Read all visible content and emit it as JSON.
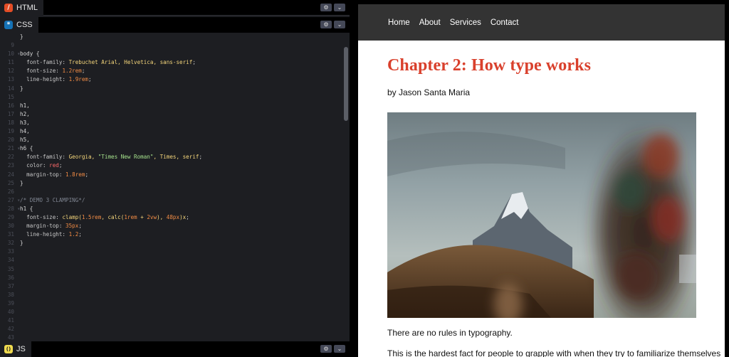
{
  "editor": {
    "html_tab": {
      "label": "HTML",
      "badge": "/"
    },
    "css_tab": {
      "label": "CSS",
      "badge": "*"
    },
    "js_tab": {
      "label": "JS",
      "badge": "()"
    },
    "settings_glyph": "⚙",
    "collapse_glyph": "⌄",
    "lines": [
      {
        "n": "",
        "fold": "",
        "t": [
          [
            "sel",
            "}"
          ]
        ]
      },
      {
        "n": "9",
        "fold": "",
        "t": []
      },
      {
        "n": "10",
        "fold": "▾",
        "t": [
          [
            "sel",
            "body {"
          ]
        ]
      },
      {
        "n": "11",
        "fold": "",
        "t": [
          [
            "prop",
            "  font-family: "
          ],
          [
            "val",
            "Trebuchet Arial, Helvetica, sans-serif"
          ],
          [
            "prop",
            ";"
          ]
        ]
      },
      {
        "n": "12",
        "fold": "",
        "t": [
          [
            "prop",
            "  font-size: "
          ],
          [
            "num",
            "1.2rem"
          ],
          [
            "prop",
            ";"
          ]
        ]
      },
      {
        "n": "13",
        "fold": "",
        "t": [
          [
            "prop",
            "  line-height: "
          ],
          [
            "num",
            "1.9rem"
          ],
          [
            "prop",
            ";"
          ]
        ]
      },
      {
        "n": "14",
        "fold": "",
        "t": [
          [
            "sel",
            "}"
          ]
        ]
      },
      {
        "n": "15",
        "fold": "",
        "t": []
      },
      {
        "n": "16",
        "fold": "",
        "t": [
          [
            "sel",
            "h1,"
          ]
        ]
      },
      {
        "n": "17",
        "fold": "",
        "t": [
          [
            "sel",
            "h2,"
          ]
        ]
      },
      {
        "n": "18",
        "fold": "",
        "t": [
          [
            "sel",
            "h3,"
          ]
        ]
      },
      {
        "n": "19",
        "fold": "",
        "t": [
          [
            "sel",
            "h4,"
          ]
        ]
      },
      {
        "n": "20",
        "fold": "",
        "t": [
          [
            "sel",
            "h5,"
          ]
        ]
      },
      {
        "n": "21",
        "fold": "▾",
        "t": [
          [
            "sel",
            "h6 {"
          ]
        ]
      },
      {
        "n": "22",
        "fold": "",
        "t": [
          [
            "prop",
            "  font-family: "
          ],
          [
            "val",
            "Georgia, "
          ],
          [
            "str",
            "\"Times New Roman\""
          ],
          [
            "val",
            ", Times, serif"
          ],
          [
            "prop",
            ";"
          ]
        ]
      },
      {
        "n": "23",
        "fold": "",
        "t": [
          [
            "prop",
            "  color: "
          ],
          [
            "kw",
            "red"
          ],
          [
            "prop",
            ";"
          ]
        ]
      },
      {
        "n": "24",
        "fold": "",
        "t": [
          [
            "prop",
            "  margin-top: "
          ],
          [
            "num",
            "1.8rem"
          ],
          [
            "prop",
            ";"
          ]
        ]
      },
      {
        "n": "25",
        "fold": "",
        "t": [
          [
            "sel",
            "}"
          ]
        ]
      },
      {
        "n": "26",
        "fold": "",
        "t": []
      },
      {
        "n": "27",
        "fold": "▾",
        "t": [
          [
            "cmt",
            "/* DEMO 3 CLAMPING*/"
          ]
        ]
      },
      {
        "n": "28",
        "fold": "▾",
        "t": [
          [
            "sel",
            "h1 {"
          ]
        ]
      },
      {
        "n": "29",
        "fold": "",
        "t": [
          [
            "prop",
            "  font-size: "
          ],
          [
            "val",
            "clamp("
          ],
          [
            "num",
            "1.5rem"
          ],
          [
            "val",
            ", calc("
          ],
          [
            "num",
            "1rem"
          ],
          [
            "val",
            " + "
          ],
          [
            "num",
            "2vw"
          ],
          [
            "val",
            "), "
          ],
          [
            "num",
            "48px"
          ],
          [
            "val",
            ")x"
          ],
          [
            "prop",
            ";"
          ]
        ]
      },
      {
        "n": "30",
        "fold": "",
        "t": [
          [
            "prop",
            "  margin-top: "
          ],
          [
            "num",
            "35px"
          ],
          [
            "prop",
            ";"
          ]
        ]
      },
      {
        "n": "31",
        "fold": "",
        "t": [
          [
            "prop",
            "  line-height: "
          ],
          [
            "num",
            "1.2"
          ],
          [
            "prop",
            ";"
          ]
        ]
      },
      {
        "n": "32",
        "fold": "",
        "t": [
          [
            "sel",
            "}"
          ]
        ]
      },
      {
        "n": "33",
        "fold": "",
        "t": []
      },
      {
        "n": "34",
        "fold": "",
        "t": []
      },
      {
        "n": "35",
        "fold": "",
        "t": []
      },
      {
        "n": "36",
        "fold": "",
        "t": []
      },
      {
        "n": "37",
        "fold": "",
        "t": []
      },
      {
        "n": "38",
        "fold": "",
        "t": []
      },
      {
        "n": "39",
        "fold": "",
        "t": []
      },
      {
        "n": "40",
        "fold": "",
        "t": []
      },
      {
        "n": "41",
        "fold": "",
        "t": []
      },
      {
        "n": "42",
        "fold": "",
        "t": []
      },
      {
        "n": "43",
        "fold": "",
        "t": []
      },
      {
        "n": "44",
        "fold": "",
        "t": []
      }
    ]
  },
  "preview": {
    "nav": [
      "Home",
      "About",
      "Services",
      "Contact"
    ],
    "title": "Chapter 2: How type works",
    "byline": "by Jason Santa Maria",
    "paragraph1": "There are no rules in typography.",
    "paragraph2": "This is the hardest fact for people to grapple with when they try to familiarize themselves"
  },
  "colors": {
    "editor_bg": "#1d1e22",
    "nav_bg": "#333333",
    "title_red": "#d9402c",
    "html_badge": "#e44d26",
    "css_badge": "#1572b6",
    "js_badge": "#f0db4f"
  }
}
